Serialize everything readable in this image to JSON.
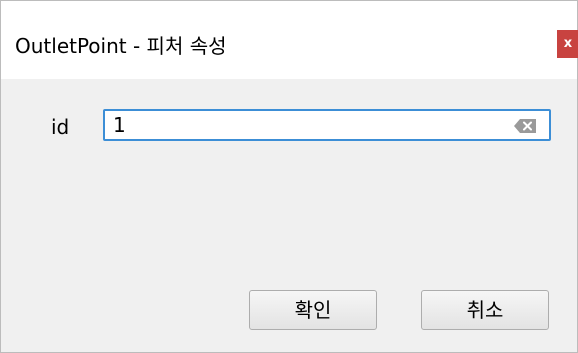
{
  "window": {
    "title": "OutletPoint - 피처 속성",
    "close_label": "x"
  },
  "form": {
    "id_label": "id",
    "id_value": "1"
  },
  "buttons": {
    "ok_label": "확인",
    "cancel_label": "취소"
  },
  "icons": {
    "close": "close-icon",
    "clear": "backspace-clear-icon"
  },
  "colors": {
    "close_button": "#c84340",
    "input_focus_border": "#3c8ed6",
    "window_background": "#f0f0f0",
    "titlebar_background": "#ffffff"
  }
}
